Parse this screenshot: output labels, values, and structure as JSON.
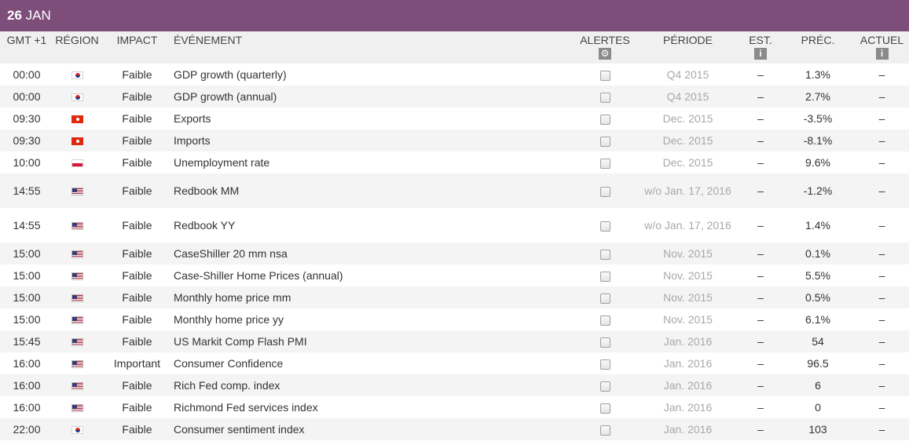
{
  "day": {
    "number": "26",
    "month": "JAN"
  },
  "columns": {
    "time": "GMT +1",
    "region": "RÉGION",
    "impact": "IMPACT",
    "event": "ÉVÉNEMENT",
    "alerts": "ALERTES",
    "period": "PÉRIODE",
    "est": "EST.",
    "prev": "PRÉC.",
    "actual": "ACTUEL"
  },
  "header_icons": {
    "alerts": "gear-icon",
    "est": "info-icon",
    "actual": "info-icon"
  },
  "colors": {
    "header_bg": "#7d4e7a",
    "period_text": "#a8a8a8"
  },
  "events": [
    {
      "time": "00:00",
      "flag": "kr",
      "impact": "Faible",
      "event": "GDP growth (quarterly)",
      "period": "Q4 2015",
      "est": "–",
      "prev": "1.3%",
      "actual": "–"
    },
    {
      "time": "00:00",
      "flag": "kr",
      "impact": "Faible",
      "event": "GDP growth (annual)",
      "period": "Q4 2015",
      "est": "–",
      "prev": "2.7%",
      "actual": "–"
    },
    {
      "time": "09:30",
      "flag": "hk",
      "impact": "Faible",
      "event": "Exports",
      "period": "Dec. 2015",
      "est": "–",
      "prev": "-3.5%",
      "actual": "–"
    },
    {
      "time": "09:30",
      "flag": "hk",
      "impact": "Faible",
      "event": "Imports",
      "period": "Dec. 2015",
      "est": "–",
      "prev": "-8.1%",
      "actual": "–"
    },
    {
      "time": "10:00",
      "flag": "pl",
      "impact": "Faible",
      "event": "Unemployment rate",
      "period": "Dec. 2015",
      "est": "–",
      "prev": "9.6%",
      "actual": "–"
    },
    {
      "time": "14:55",
      "flag": "us",
      "impact": "Faible",
      "event": "Redbook MM",
      "period": "w/o Jan. 17, 2016",
      "est": "–",
      "prev": "-1.2%",
      "actual": "–"
    },
    {
      "time": "14:55",
      "flag": "us",
      "impact": "Faible",
      "event": "Redbook YY",
      "period": "w/o Jan. 17, 2016",
      "est": "–",
      "prev": "1.4%",
      "actual": "–"
    },
    {
      "time": "15:00",
      "flag": "us",
      "impact": "Faible",
      "event": "CaseShiller 20 mm nsa",
      "period": "Nov. 2015",
      "est": "–",
      "prev": "0.1%",
      "actual": "–"
    },
    {
      "time": "15:00",
      "flag": "us",
      "impact": "Faible",
      "event": "Case-Shiller Home Prices (annual)",
      "period": "Nov. 2015",
      "est": "–",
      "prev": "5.5%",
      "actual": "–"
    },
    {
      "time": "15:00",
      "flag": "us",
      "impact": "Faible",
      "event": "Monthly home price mm",
      "period": "Nov. 2015",
      "est": "–",
      "prev": "0.5%",
      "actual": "–"
    },
    {
      "time": "15:00",
      "flag": "us",
      "impact": "Faible",
      "event": "Monthly home price yy",
      "period": "Nov. 2015",
      "est": "–",
      "prev": "6.1%",
      "actual": "–"
    },
    {
      "time": "15:45",
      "flag": "us",
      "impact": "Faible",
      "event": "US Markit Comp Flash PMI",
      "period": "Jan. 2016",
      "est": "–",
      "prev": "54",
      "actual": "–"
    },
    {
      "time": "16:00",
      "flag": "us",
      "impact": "Important",
      "event": "Consumer Confidence",
      "period": "Jan. 2016",
      "est": "–",
      "prev": "96.5",
      "actual": "–"
    },
    {
      "time": "16:00",
      "flag": "us",
      "impact": "Faible",
      "event": "Rich Fed comp. index",
      "period": "Jan. 2016",
      "est": "–",
      "prev": "6",
      "actual": "–"
    },
    {
      "time": "16:00",
      "flag": "us",
      "impact": "Faible",
      "event": "Richmond Fed services index",
      "period": "Jan. 2016",
      "est": "–",
      "prev": "0",
      "actual": "–"
    },
    {
      "time": "22:00",
      "flag": "kr",
      "impact": "Faible",
      "event": "Consumer sentiment index",
      "period": "Jan. 2016",
      "est": "–",
      "prev": "103",
      "actual": "–"
    }
  ]
}
